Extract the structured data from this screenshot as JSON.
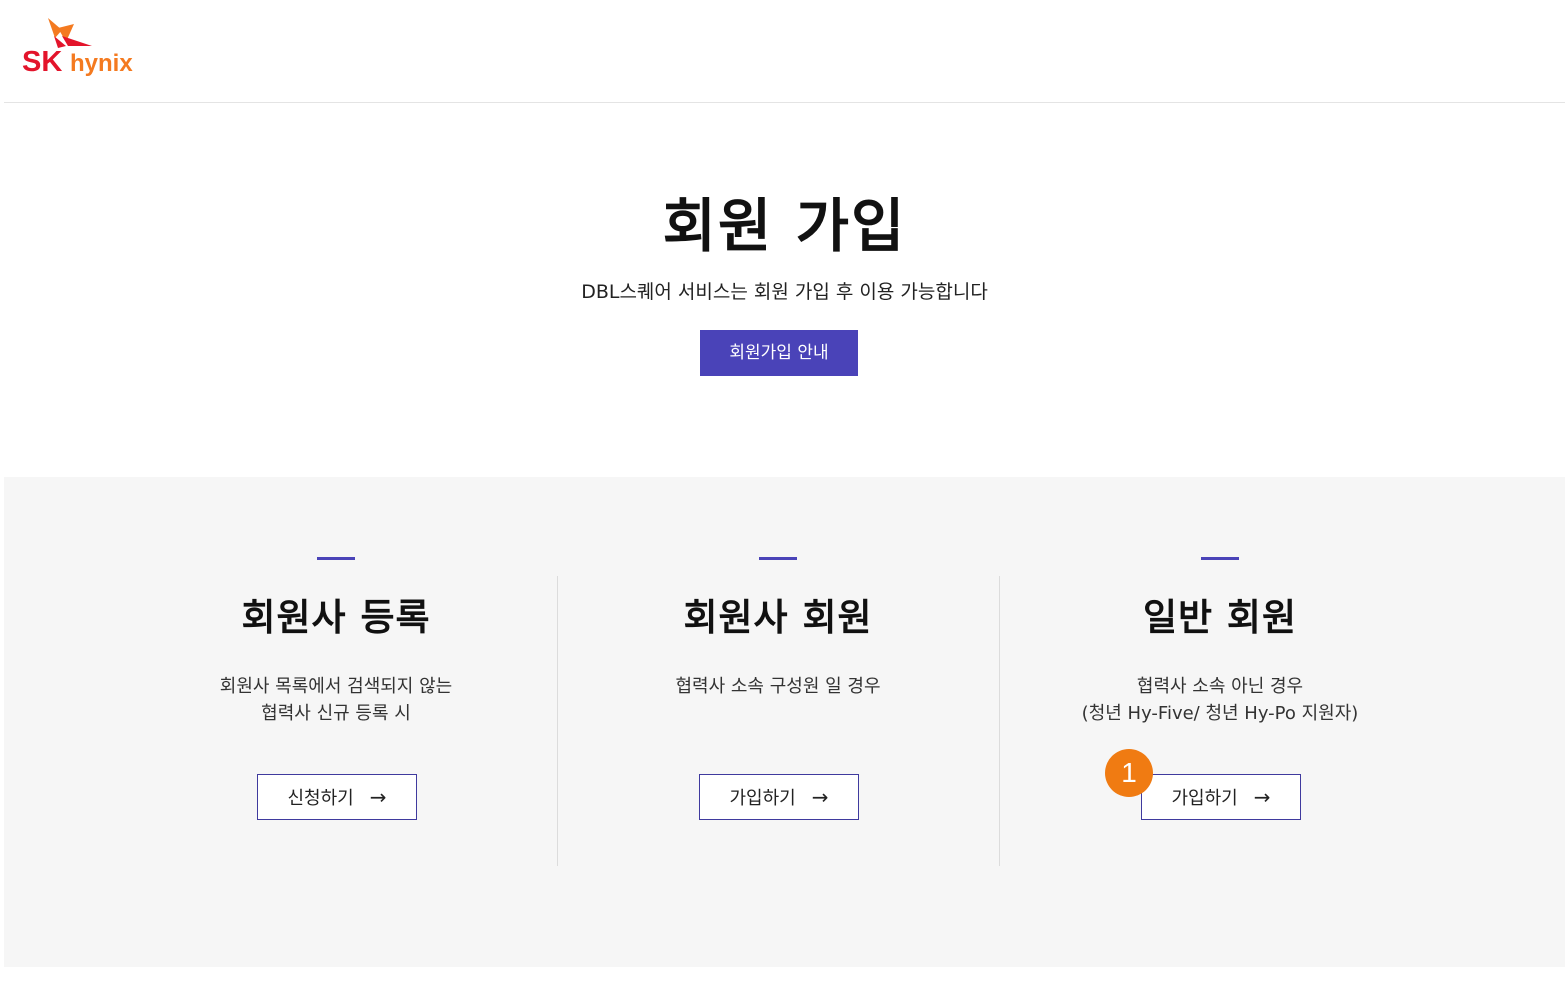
{
  "header": {
    "logo_text_sk": "SK",
    "logo_text_hynix": "hynix",
    "colors": {
      "sk_red": "#e3142b",
      "butterfly_orange": "#f47a20"
    }
  },
  "hero": {
    "title": "회원 가입",
    "subtitle": "DBL스퀘어 서비스는 회원 가입 후 이용 가능합니다",
    "guide_button": "회원가입 안내"
  },
  "cards": [
    {
      "title": "회원사 등록",
      "desc": [
        "회원사 목록에서 검색되지 않는",
        "협력사 신규 등록 시"
      ],
      "button": "신청하기",
      "arrow": "→"
    },
    {
      "title": "회원사 회원",
      "desc": [
        "협력사 소속 구성원 일 경우"
      ],
      "button": "가입하기",
      "arrow": "→"
    },
    {
      "title": "일반 회원",
      "desc": [
        "협력사 소속 아닌 경우",
        "(청년 Hy-Five/ 청년 Hy-Po 지원자)"
      ],
      "button": "가입하기",
      "arrow": "→"
    }
  ],
  "annotation_badge": "1",
  "colors": {
    "accent": "#4a43b8",
    "badge": "#f07b12",
    "section_bg": "#f6f6f6"
  }
}
